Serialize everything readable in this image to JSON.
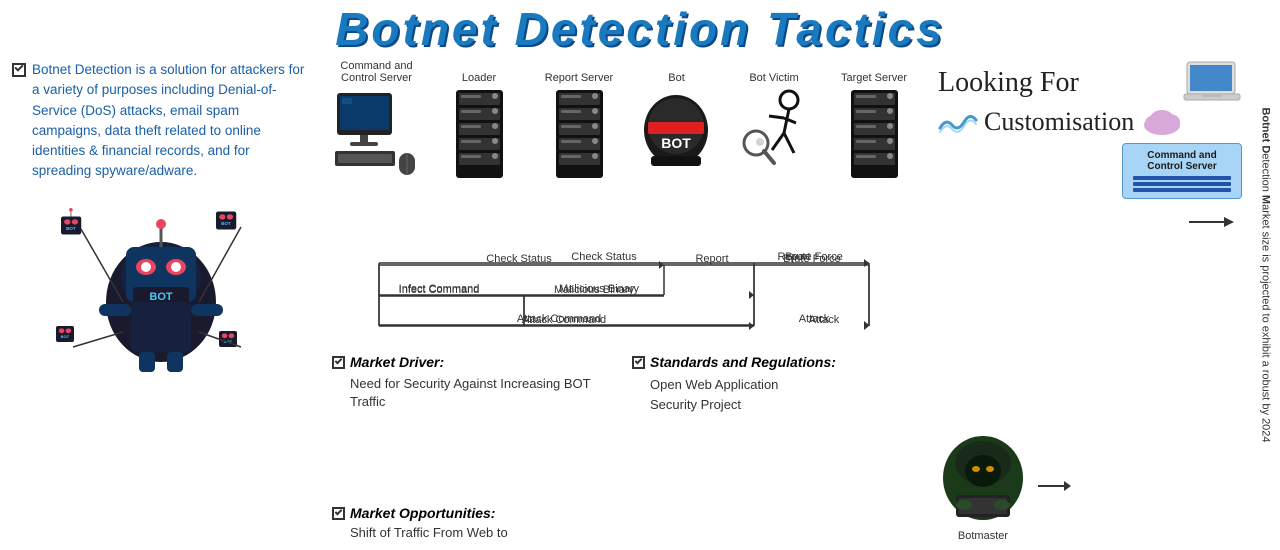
{
  "title": "Botnet Detection Tactics",
  "description": "Botnet Detection is a solution for attackers for a variety of purposes including Denial-of-Service (DoS) attacks, email spam campaigns, data theft related to online identities & financial records, and for spreading spyware/adware.",
  "servers": {
    "items": [
      {
        "label": "Command and Control Server",
        "type": "pc"
      },
      {
        "label": "Loader",
        "type": "server"
      },
      {
        "label": "Report Server",
        "type": "server"
      },
      {
        "label": "Bot",
        "type": "bot"
      },
      {
        "label": "Bot Victim",
        "type": "victim"
      },
      {
        "label": "Target Server",
        "type": "server"
      }
    ]
  },
  "flow_labels": {
    "check_status": "Check Status",
    "report": "Report",
    "brute_force": "Brute Force",
    "infect_command": "Infect Command",
    "malicious_binary": "Malicious Binary",
    "attack_command": "Attack Command",
    "attack": "Attack"
  },
  "market_driver": {
    "header": "Market Driver:",
    "content": "Need for Security Against Increasing BOT Traffic"
  },
  "standards": {
    "header": "Standards and Regulations:",
    "line1": "Open Web Application",
    "line2": "Security Project"
  },
  "market_opportunities": {
    "header": "Market Opportunities:",
    "content": "Shift of Traffic From Web to"
  },
  "looking_for": "Looking For",
  "customisation": "Customisation",
  "command_control_label": "Command and Control Server",
  "botmaster_label": "Botmaster",
  "rotated_text": "Botnet Detection Market size is projected to exhibit a robust by 2024"
}
